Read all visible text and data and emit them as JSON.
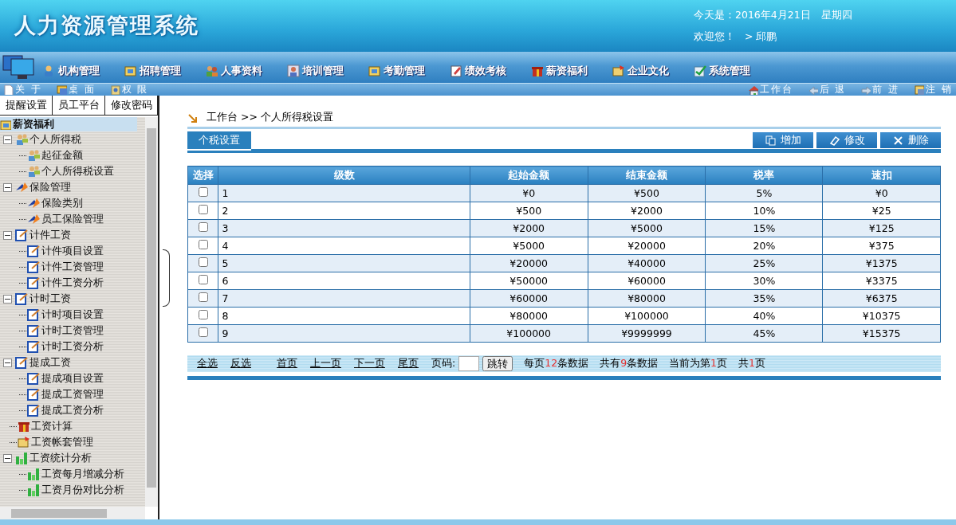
{
  "header": {
    "title": "人力资源管理系统",
    "date": "今天是：2016年4月21日　星期四",
    "welcome": "欢迎您！",
    "user": "> 邱鹏"
  },
  "nav": [
    "机构管理",
    "招聘管理",
    "人事资料",
    "培训管理",
    "考勤管理",
    "绩效考核",
    "薪资福利",
    "企业文化",
    "系统管理"
  ],
  "subbar": {
    "left": [
      "关 于",
      "桌 面",
      "权 限"
    ],
    "right": [
      "工作台",
      "后 退",
      "前 进",
      "注 销"
    ]
  },
  "left_tabs": [
    {
      "label": "提醒设置",
      "selected": false
    },
    {
      "label": "员工平台",
      "selected": false
    },
    {
      "label": "修改密码",
      "selected": false
    }
  ],
  "tree": {
    "title": "薪资福利",
    "items": [
      {
        "label": "个人所得税",
        "expanded": true,
        "children": [
          {
            "label": "起征金额"
          },
          {
            "label": "个人所得税设置"
          }
        ]
      },
      {
        "label": "保险管理",
        "expanded": true,
        "children": [
          {
            "label": "保险类别"
          },
          {
            "label": "员工保险管理"
          }
        ]
      },
      {
        "label": "计件工资",
        "expanded": true,
        "children": [
          {
            "label": "计件项目设置"
          },
          {
            "label": "计件工资管理"
          },
          {
            "label": "计件工资分析"
          }
        ]
      },
      {
        "label": "计时工资",
        "expanded": true,
        "children": [
          {
            "label": "计时项目设置"
          },
          {
            "label": "计时工资管理"
          },
          {
            "label": "计时工资分析"
          }
        ]
      },
      {
        "label": "提成工资",
        "expanded": true,
        "children": [
          {
            "label": "提成项目设置"
          },
          {
            "label": "提成工资管理"
          },
          {
            "label": "提成工资分析"
          }
        ]
      },
      {
        "label": "工资计算"
      },
      {
        "label": "工资帐套管理"
      },
      {
        "label": "工资统计分析",
        "expanded": true,
        "children": [
          {
            "label": "工资每月增减分析"
          },
          {
            "label": "工资月份对比分析"
          }
        ]
      }
    ]
  },
  "breadcrumb": "工作台 >> 个人所得税设置",
  "section_tab": "个税设置",
  "actions": [
    "增加",
    "修改",
    "删除"
  ],
  "table": {
    "columns": [
      "选择",
      "级数",
      "起始金额",
      "结束金额",
      "税率",
      "速扣"
    ],
    "rows": [
      {
        "checked": false,
        "cells": [
          "",
          "1",
          "¥0",
          "¥500",
          "5%",
          "¥0"
        ]
      },
      {
        "checked": false,
        "cells": [
          "",
          "2",
          "¥500",
          "¥2000",
          "10%",
          "¥25"
        ]
      },
      {
        "checked": false,
        "cells": [
          "",
          "3",
          "¥2000",
          "¥5000",
          "15%",
          "¥125"
        ]
      },
      {
        "checked": false,
        "cells": [
          "",
          "4",
          "¥5000",
          "¥20000",
          "20%",
          "¥375"
        ]
      },
      {
        "checked": false,
        "cells": [
          "",
          "5",
          "¥20000",
          "¥40000",
          "25%",
          "¥1375"
        ]
      },
      {
        "checked": false,
        "cells": [
          "",
          "6",
          "¥50000",
          "¥60000",
          "30%",
          "¥3375"
        ]
      },
      {
        "checked": false,
        "cells": [
          "",
          "7",
          "¥60000",
          "¥80000",
          "35%",
          "¥6375"
        ]
      },
      {
        "checked": false,
        "cells": [
          "",
          "8",
          "¥80000",
          "¥100000",
          "40%",
          "¥10375"
        ]
      },
      {
        "checked": false,
        "cells": [
          "",
          "9",
          "¥100000",
          "¥9999999",
          "45%",
          "¥15375"
        ]
      }
    ]
  },
  "pager": {
    "links": [
      "全选",
      "反选",
      "首页",
      "上一页",
      "下一页",
      "尾页"
    ],
    "page_label": "页码:",
    "jump": "跳转",
    "stats": [
      {
        "before": "每页",
        "count": "12",
        "after": "条数据"
      },
      {
        "before": "共有",
        "count": "9",
        "after": "条数据"
      },
      {
        "before": "当前为第",
        "count": "1",
        "after": "页"
      },
      {
        "before": "共",
        "count": "1",
        "after": "页"
      }
    ]
  }
}
